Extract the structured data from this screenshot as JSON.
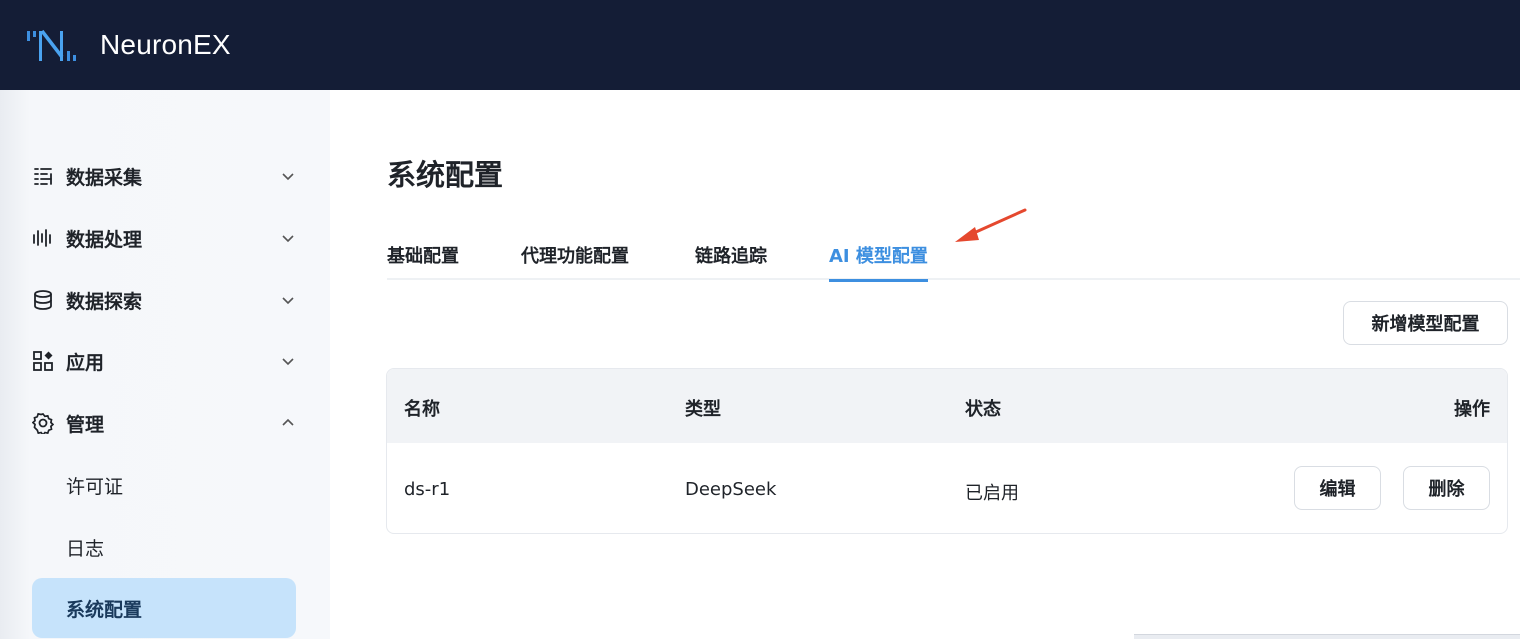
{
  "app": {
    "name": "NeuronEX"
  },
  "sidebar": {
    "items": [
      {
        "label": "数据采集",
        "icon": "data-collection-icon",
        "expanded": false
      },
      {
        "label": "数据处理",
        "icon": "data-processing-icon",
        "expanded": false
      },
      {
        "label": "数据探索",
        "icon": "database-icon",
        "expanded": false
      },
      {
        "label": "应用",
        "icon": "apps-icon",
        "expanded": false
      },
      {
        "label": "管理",
        "icon": "gear-icon",
        "expanded": true
      }
    ],
    "subitems": [
      {
        "label": "许可证",
        "active": false
      },
      {
        "label": "日志",
        "active": false
      },
      {
        "label": "系统配置",
        "active": true
      }
    ]
  },
  "main": {
    "title": "系统配置",
    "tabs": [
      {
        "label": "基础配置",
        "active": false
      },
      {
        "label": "代理功能配置",
        "active": false
      },
      {
        "label": "链路追踪",
        "active": false
      },
      {
        "label": "AI 模型配置",
        "active": true
      }
    ],
    "add_button": "新增模型配置",
    "table": {
      "columns": [
        "名称",
        "类型",
        "状态",
        "操作"
      ],
      "rows": [
        {
          "name": "ds-r1",
          "type": "DeepSeek",
          "status": "已启用",
          "edit": "编辑",
          "delete": "删除"
        }
      ]
    }
  },
  "colors": {
    "topbar": "#141d36",
    "accent": "#3d8fe0",
    "active_subitem": "#c6e3fb",
    "annotation_arrow": "#e5482e"
  }
}
